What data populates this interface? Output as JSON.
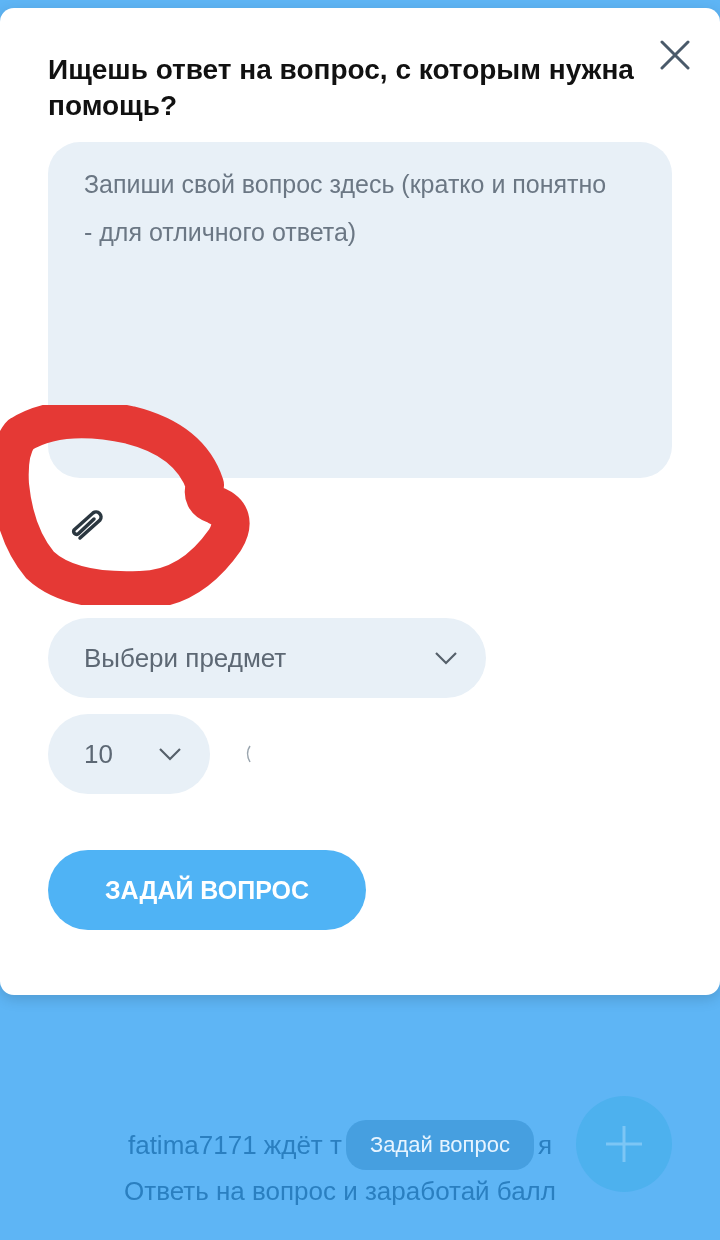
{
  "modal": {
    "title": "Ищешь ответ на вопрос, с которым нужна помощь?",
    "question": {
      "placeholder": "Запиши свой вопрос здесь (кратко и понятно - для отличного ответа)"
    },
    "subject": {
      "placeholder": "Выбери предмет"
    },
    "points": {
      "value": "10"
    },
    "loading": true,
    "submit": "ЗАДАЙ ВОПРОС"
  },
  "background": {
    "line_1_start": "fatima7171 ждёт т",
    "ask_button": "Задай вопрос",
    "line_1_end": "я",
    "line_2": "Ответь на вопрос и заработай балл"
  }
}
